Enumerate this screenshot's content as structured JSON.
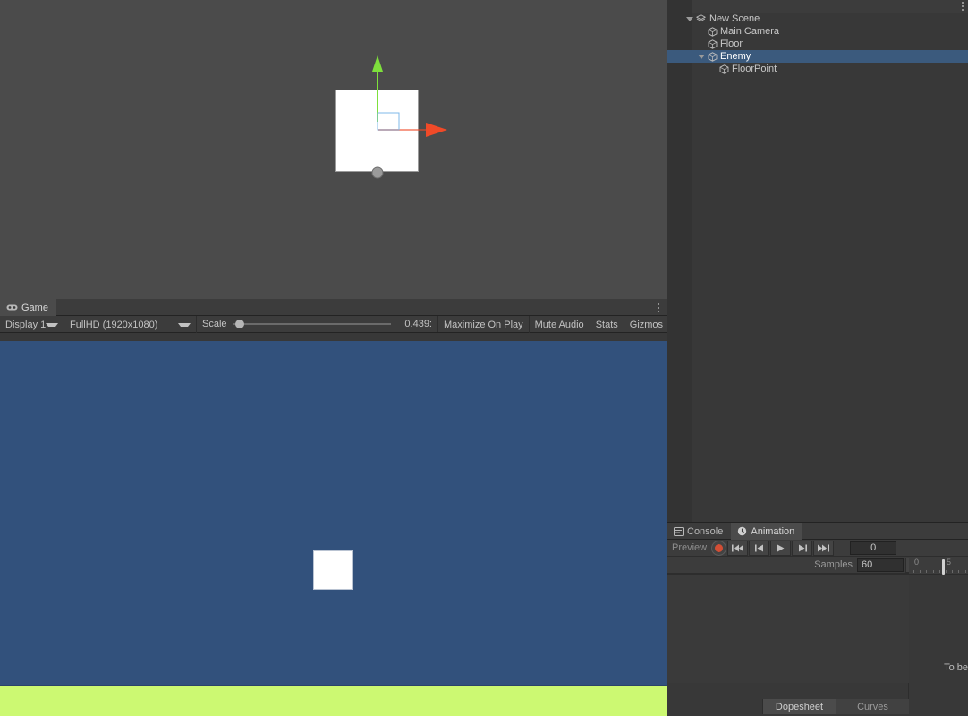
{
  "scene_view": {
    "name": "scene-viewport",
    "background_color": "#4b4b4b",
    "sprite_color": "#ffffff",
    "gizmo": {
      "type": "move-tool",
      "y_axis_color": "#7ee03c",
      "x_axis_color": "#f04a28",
      "plane_handle_color": "#7fb8e8",
      "center_handle_color": "#9a9a9a"
    }
  },
  "game_panel": {
    "tab_label": "Game",
    "tab_icon": "gamepad-icon",
    "toolbar": {
      "display_label": "Display 1",
      "resolution_label": "FullHD (1920x1080)",
      "scale_label": "Scale",
      "scale_value": "0.439:",
      "scale_slider_percent": 2,
      "maximize_label": "Maximize On Play",
      "mute_label": "Mute Audio",
      "stats_label": "Stats",
      "gizmos_label": "Gizmos"
    },
    "render": {
      "sky_color": "#32517c",
      "ground_color": "#ccf972",
      "player_color": "#ffffff"
    }
  },
  "hierarchy": {
    "items": [
      {
        "label": "New Scene",
        "icon": "scene-icon",
        "depth": 0,
        "foldout": "open",
        "selected": false
      },
      {
        "label": "Main Camera",
        "icon": "cube-icon",
        "depth": 1,
        "foldout": "none",
        "selected": false
      },
      {
        "label": "Floor",
        "icon": "cube-icon",
        "depth": 1,
        "foldout": "none",
        "selected": false
      },
      {
        "label": "Enemy",
        "icon": "cube-icon",
        "depth": 1,
        "foldout": "open",
        "selected": true
      },
      {
        "label": "FloorPoint",
        "icon": "cube-icon",
        "depth": 2,
        "foldout": "none",
        "selected": false
      }
    ],
    "selection_color": "#3b5a7d"
  },
  "animation_panel": {
    "tabs": [
      {
        "label": "Console",
        "icon": "console-icon",
        "active": false
      },
      {
        "label": "Animation",
        "icon": "clock-icon",
        "active": true
      }
    ],
    "preview_label": "Preview",
    "record_button": "record-button",
    "playback": [
      {
        "name": "first-frame-button"
      },
      {
        "name": "previous-frame-button"
      },
      {
        "name": "play-button"
      },
      {
        "name": "next-frame-button"
      },
      {
        "name": "last-frame-button"
      }
    ],
    "frame_value": "0",
    "samples_label": "Samples",
    "samples_value": "60",
    "keyframe_buttons": [
      {
        "name": "add-keyframe-filter-button"
      },
      {
        "name": "add-keyframe-button"
      },
      {
        "name": "add-event-button"
      }
    ],
    "timeline": {
      "tick_labels": [
        "0",
        "5"
      ],
      "playhead_frame": 0
    },
    "empty_message": "To be",
    "view_tabs": [
      {
        "label": "Dopesheet",
        "active": true
      },
      {
        "label": "Curves",
        "active": false
      }
    ]
  }
}
